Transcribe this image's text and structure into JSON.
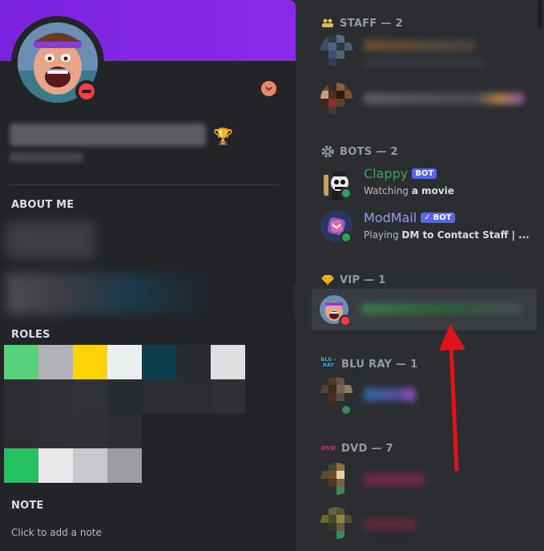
{
  "profile": {
    "about_heading": "ABOUT ME",
    "roles_heading": "ROLES",
    "note_heading": "NOTE",
    "note_placeholder": "Click to add a note",
    "role_colors": [
      [
        "#57d27a",
        "#b1b3b8",
        "#fdd20b",
        "#ebeff0",
        "#0d3e4b",
        "#2a2b2f",
        "#dfdfe1"
      ],
      [
        "#2b2d31",
        "#2d2f33",
        "#313236",
        "#2a2d2f",
        "#2c2e32",
        "#2b2d31",
        "#2e3034"
      ],
      [
        "#2b2d31",
        "#2e3034",
        "#2f3135",
        "#2c2e32"
      ],
      [
        "#24c25f",
        "#e8e8ea",
        "#c8c9cc",
        "#9c9da0"
      ]
    ],
    "status_color": "#f23f43",
    "banner_color": "#7a22e0"
  },
  "members": {
    "groups": {
      "staff": "STAFF — 2",
      "bots": "BOTS — 2",
      "vip": "VIP — 1",
      "bluray": "BLU RAY — 1",
      "dvd": "DVD — 7"
    },
    "bot_label": "BOT",
    "clappy": {
      "name": "Clappy",
      "activity_prefix": "Watching",
      "activity_value": "a movie",
      "name_color": "#3ba55c"
    },
    "modmail": {
      "name": "ModMail",
      "activity_prefix": "Playing",
      "activity_value": "DM to Contact Staff | ...",
      "name_color": "#949cf7"
    },
    "bluray_icon_text": "BLU - RAY",
    "dvd_icon_text": "DVD",
    "online_color": "#23a55a"
  }
}
